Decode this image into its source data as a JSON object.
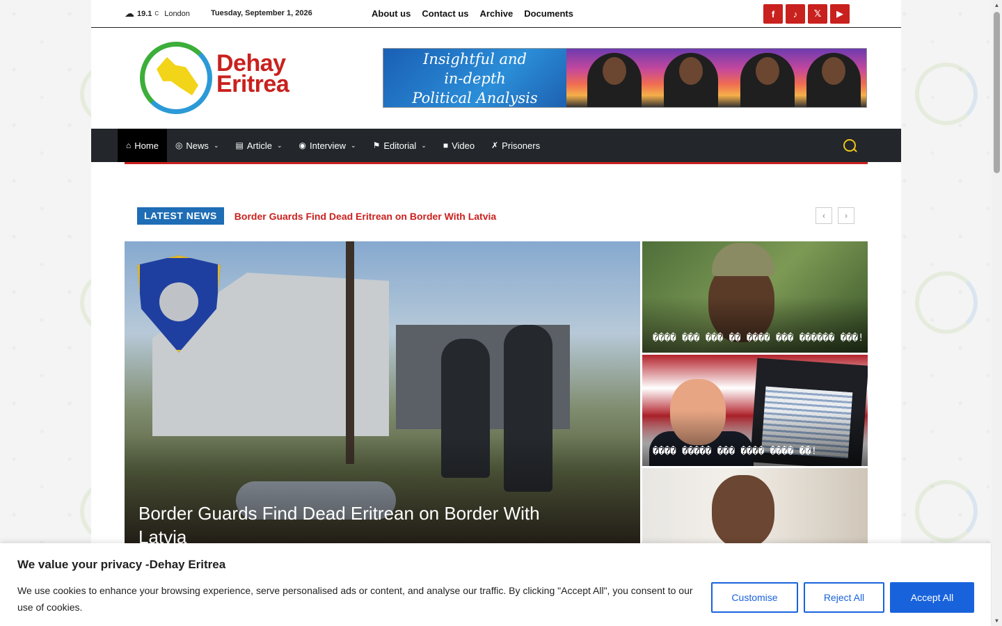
{
  "topbar": {
    "weather": {
      "temp": "19.1",
      "unit": "C",
      "city": "London",
      "icon": "cloud-icon"
    },
    "date": "Tuesday, September 1, 2026",
    "links": [
      "About us",
      "Contact us",
      "Archive",
      "Documents"
    ],
    "social": [
      {
        "name": "facebook-icon",
        "glyph": "f"
      },
      {
        "name": "tiktok-icon",
        "glyph": "♪"
      },
      {
        "name": "x-icon",
        "glyph": "𝕏"
      },
      {
        "name": "youtube-icon",
        "glyph": "▶"
      }
    ]
  },
  "header": {
    "logo_line1": "Dehay",
    "logo_line2": "Eritrea",
    "banner": {
      "line1": "Insightful and",
      "line2": "in-depth",
      "line3": "Political Analysis"
    }
  },
  "nav": {
    "items": [
      {
        "label": "Home",
        "icon": "⌂",
        "icon_name": "home-icon",
        "caret": false
      },
      {
        "label": "News",
        "icon": "◎",
        "icon_name": "globe-icon",
        "caret": true
      },
      {
        "label": "Article",
        "icon": "▤",
        "icon_name": "newspaper-icon",
        "caret": true
      },
      {
        "label": "Interview",
        "icon": "◉",
        "icon_name": "handshake-icon",
        "caret": true
      },
      {
        "label": "Editorial",
        "icon": "⚑",
        "icon_name": "flag-icon",
        "caret": true
      },
      {
        "label": "Video",
        "icon": "■",
        "icon_name": "video-icon",
        "caret": false
      },
      {
        "label": "Prisoners",
        "icon": "✗",
        "icon_name": "prisoner-icon",
        "caret": false
      }
    ]
  },
  "latest": {
    "tag": "LATEST NEWS",
    "headline": "Border Guards Find Dead Eritrean on Border With Latvia",
    "prev": "‹",
    "next": "›"
  },
  "feature": {
    "title": "Border Guards Find Dead Eritrean on Border With Latvia"
  },
  "side_posts": [
    {
      "title": "���� ��� ��� �� ���� ��� ������ ���!"
    },
    {
      "title": "���� ����� ��� ���� ���� ��!"
    },
    {
      "title": ""
    }
  ],
  "cookie": {
    "title": "We value your privacy -Dehay Eritrea",
    "text": "We use cookies to enhance your browsing experience, serve personalised ads or content, and analyse our traffic. By clicking \"Accept All\", you consent to our use of cookies.",
    "customise": "Customise",
    "reject": "Reject All",
    "accept": "Accept All"
  },
  "colors": {
    "brand_red": "#c9211e",
    "nav_bg": "#23272b",
    "accent_blue": "#1863dc",
    "latest_blue": "#1e6db5"
  }
}
